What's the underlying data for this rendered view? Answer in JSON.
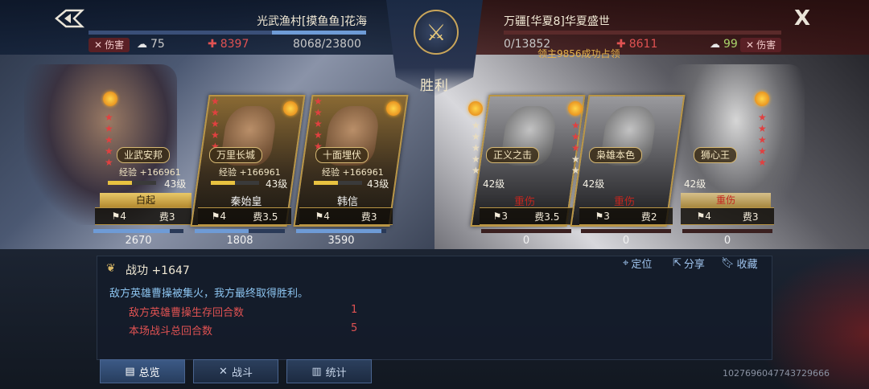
{
  "header": {
    "left_team_name": "光武渔村[摸鱼鱼]花海",
    "right_team_name": "万疆[华夏8]华夏盛世",
    "victory_label": "胜利",
    "lord_message": "领主9856成功占领",
    "back_icon": "back-arrow-icon",
    "close_label": "X"
  },
  "left_stats": {
    "damage_label": "伤害",
    "morale": "75",
    "wounded": "8397",
    "troops_text": "8068/23800",
    "troops_fraction": 0.339
  },
  "right_stats": {
    "troops_text": "0/13852",
    "troops_fraction": 0.0,
    "wounded": "8611",
    "morale": "99",
    "damage_label": "伤害"
  },
  "left_heroes": [
    {
      "name": "白起",
      "skill": "业武安邦",
      "exp": "经验 +166961",
      "level": "43级",
      "level_fraction": 0.5,
      "troop_type": "4",
      "cost": "费3",
      "troops": "2670",
      "troop_fraction": 0.85,
      "stars_on": 5
    },
    {
      "name": "秦始皇",
      "skill": "万里长城",
      "exp": "经验 +166961",
      "level": "43级",
      "level_fraction": 0.5,
      "troop_type": "4",
      "cost": "费3.5",
      "troops": "1808",
      "troop_fraction": 0.6,
      "stars_on": 5
    },
    {
      "name": "韩信",
      "skill": "十面埋伏",
      "exp": "经验 +166961",
      "level": "43级",
      "level_fraction": 0.5,
      "troop_type": "4",
      "cost": "费3",
      "troops": "3590",
      "troop_fraction": 0.95,
      "stars_on": 5
    }
  ],
  "right_heroes": [
    {
      "status": "重伤",
      "skill": "正义之击",
      "level": "42级",
      "troop_type": "3",
      "cost": "费3.5",
      "troops": "0",
      "troop_fraction": 0.0,
      "stars_on": 0
    },
    {
      "status": "重伤",
      "skill": "枭雄本色",
      "level": "42级",
      "troop_type": "3",
      "cost": "费2",
      "troops": "0",
      "troop_fraction": 0.0,
      "stars_on": 3
    },
    {
      "status": "重伤",
      "skill": "狮心王",
      "level": "42级",
      "troop_type": "4",
      "cost": "费3",
      "troops": "0",
      "troop_fraction": 0.0,
      "stars_on": 5
    }
  ],
  "report": {
    "merit_label": "战功 +1647",
    "locate_label": "定位",
    "share_label": "分享",
    "collect_label": "收藏",
    "summary": "敌方英雄曹操被集火，我方最终取得胜利。",
    "rows": [
      {
        "label": "敌方英雄曹操生存回合数",
        "value": "1"
      },
      {
        "label": "本场战斗总回合数",
        "value": "5"
      }
    ]
  },
  "tabs": [
    {
      "label": "总览",
      "icon": "document-icon"
    },
    {
      "label": "战斗",
      "icon": "crossed-swords-icon"
    },
    {
      "label": "统计",
      "icon": "bar-chart-icon"
    }
  ],
  "battle_id": "1027696047743729666",
  "colors": {
    "gold": "#b99545",
    "red": "#e05252",
    "blue": "#6e9bd6",
    "green": "#a9d36a"
  }
}
